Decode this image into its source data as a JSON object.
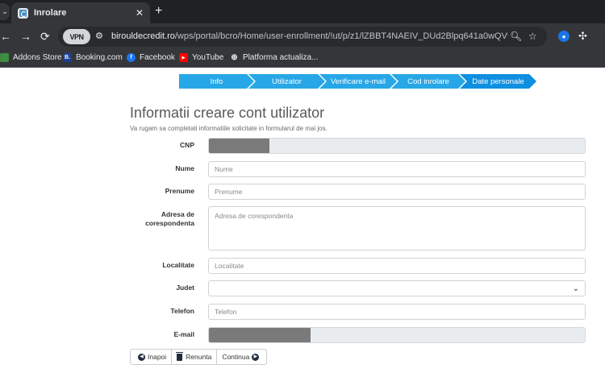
{
  "browser": {
    "tab": {
      "title": "Inrolare",
      "close": "✕"
    },
    "new_tab": "+",
    "nav": {
      "back": "←",
      "forward": "→",
      "reload": "⟳"
    },
    "vpn_label": "VPN",
    "url_host": "birouldecredit.ro",
    "url_path": "/wps/portal/bcro/Home/user-enrollment/!ut/p/z1/lZBBT4NAEIV_DUd2Blpq641a0wQVUw0...",
    "bookmarks": [
      {
        "label": "Addons Store",
        "icon_color": "#3c8d40",
        "glyph": ""
      },
      {
        "label": "Booking.com",
        "icon_color": "#1c3f94",
        "glyph": "B."
      },
      {
        "label": "Facebook",
        "icon_color": "#1877f2",
        "glyph": "f"
      },
      {
        "label": "YouTube",
        "icon_color": "#ff0000",
        "glyph": "▶"
      },
      {
        "label": "Platforma actualiza...",
        "icon_color": "#9aa0a6",
        "glyph": "⊕"
      }
    ]
  },
  "wizard": {
    "steps": [
      "Info",
      "Utilizator",
      "Verificare e-mail",
      "Cod inrolare",
      "Date personale"
    ],
    "active_step": 4
  },
  "form": {
    "title": "Informatii creare cont utilizator",
    "subtitle": "Va rugam sa completati informatiile solicitate in formularul de mai jos.",
    "fields": {
      "cnp": {
        "label": "CNP"
      },
      "nume": {
        "label": "Nume",
        "placeholder": "Nume"
      },
      "prenume": {
        "label": "Prenume",
        "placeholder": "Prenume"
      },
      "adresa": {
        "label": "Adresa de corespondenta",
        "placeholder": "Adresa de corespondenta"
      },
      "localitate": {
        "label": "Localitate",
        "placeholder": "Localitate"
      },
      "judet": {
        "label": "Judet",
        "value": ""
      },
      "telefon": {
        "label": "Telefon",
        "placeholder": "Telefon"
      },
      "email": {
        "label": "E-mail"
      }
    },
    "buttons": {
      "back": "Inapoi",
      "cancel": "Renunta",
      "continue": "Continua"
    }
  },
  "colors": {
    "step_bg": "#27a7e7",
    "step_active": "#0f8fe0",
    "masked": "#7a7a7a"
  }
}
